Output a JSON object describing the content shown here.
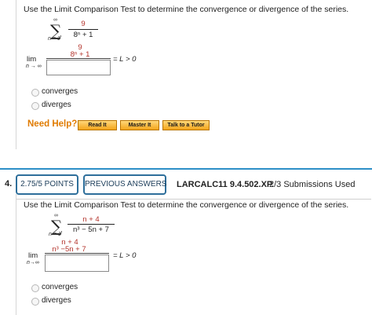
{
  "q1": {
    "prompt": "Use the Limit Comparison Test to determine the convergence or divergence of the series.",
    "sum_upper": "∞",
    "sum_lower": "n = 1",
    "series_num": "9",
    "series_den": "8ⁿ + 1",
    "lim_num": "9",
    "lim_den": "8ⁿ + 1",
    "lim_label": "lim",
    "lim_sub": "n → ∞",
    "lim_rhs": "= L > 0",
    "options": [
      "converges",
      "diverges"
    ],
    "need_help": "Need Help?",
    "help_buttons": [
      "Read It",
      "Master It",
      "Talk to a Tutor"
    ]
  },
  "header": {
    "number": "4.",
    "points_label": "2.75/5 POINTS",
    "previous_label": "PREVIOUS ANSWERS",
    "course_code": "LARCALC11 9.4.502.XP.",
    "submissions": "2/3 Submissions Used"
  },
  "q2": {
    "prompt": "Use the Limit Comparison Test to determine the convergence or divergence of the series.",
    "sum_upper": "∞",
    "sum_lower": "n = 1",
    "series_num": "n + 4",
    "series_den": "n³ − 5n + 7",
    "lim_num": "n + 4",
    "lim_den": "n³ −5n + 7",
    "lim_label": "lim",
    "lim_sub": "n→∞",
    "lim_rhs": "= L > 0",
    "options": [
      "converges",
      "diverges"
    ]
  },
  "colors": {
    "accent_blue": "#2e8fc7",
    "fraction_red": "#b3322a",
    "help_orange": "#e07b00"
  }
}
